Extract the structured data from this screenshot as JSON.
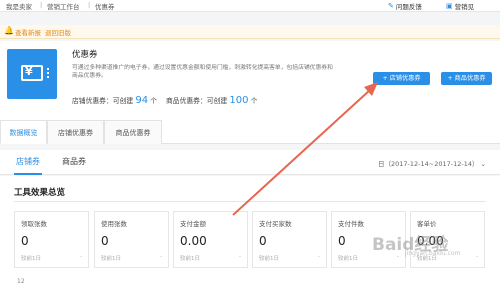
{
  "breadcrumb": {
    "items": [
      "我是卖家",
      "营销工作台",
      "优惠券"
    ]
  },
  "top_links": {
    "feedback": "问题反馈",
    "help": "营销见"
  },
  "notice": {
    "new_feature": "查看新报",
    "back_old": "退回旧版"
  },
  "product": {
    "icon": "coupon-yen-icon",
    "title": "优惠券",
    "description": "可通过多种渠道推广的电子券，通过设置优惠金额和使用门槛，刺激转化提高客单，包括店铺优惠券和商品优惠券。",
    "shop_stat_label": "店铺优惠券：可创建",
    "shop_stat_value": "94",
    "item_stat_label": "商品优惠券：可创建",
    "item_stat_value": "100",
    "unit": "个"
  },
  "buttons": {
    "create_shop": "+ 店铺优惠券",
    "create_item": "+ 商品优惠券"
  },
  "main_tabs": [
    "数据概览",
    "店铺优惠券",
    "商品优惠券"
  ],
  "sub_tabs": [
    "店铺券",
    "商品券"
  ],
  "date_range": "日（2017-12-14~2017-12-14）",
  "panel": {
    "title": "工具效果总览",
    "metrics": [
      {
        "label": "领取张数",
        "value": "0",
        "compare": "较前1日",
        "trend": "-"
      },
      {
        "label": "使用张数",
        "value": "0",
        "compare": "较前1日",
        "trend": "-"
      },
      {
        "label": "支付金额",
        "value": "0.00",
        "compare": "较前1日",
        "trend": "-"
      },
      {
        "label": "支付买家数",
        "value": "0",
        "compare": "较前1日",
        "trend": "-"
      },
      {
        "label": "支付件数",
        "value": "0",
        "compare": "较前1日",
        "trend": "-"
      },
      {
        "label": "客单价",
        "value": "0.00",
        "compare": "较前1日",
        "trend": "-"
      }
    ],
    "footer": "12"
  },
  "watermark": {
    "text": "Baid经验",
    "sub": "jingyan.baidu.com"
  },
  "colors": {
    "accent": "#2a8fe6",
    "arrow": "#e8664f",
    "notice": "#e08a1e"
  }
}
